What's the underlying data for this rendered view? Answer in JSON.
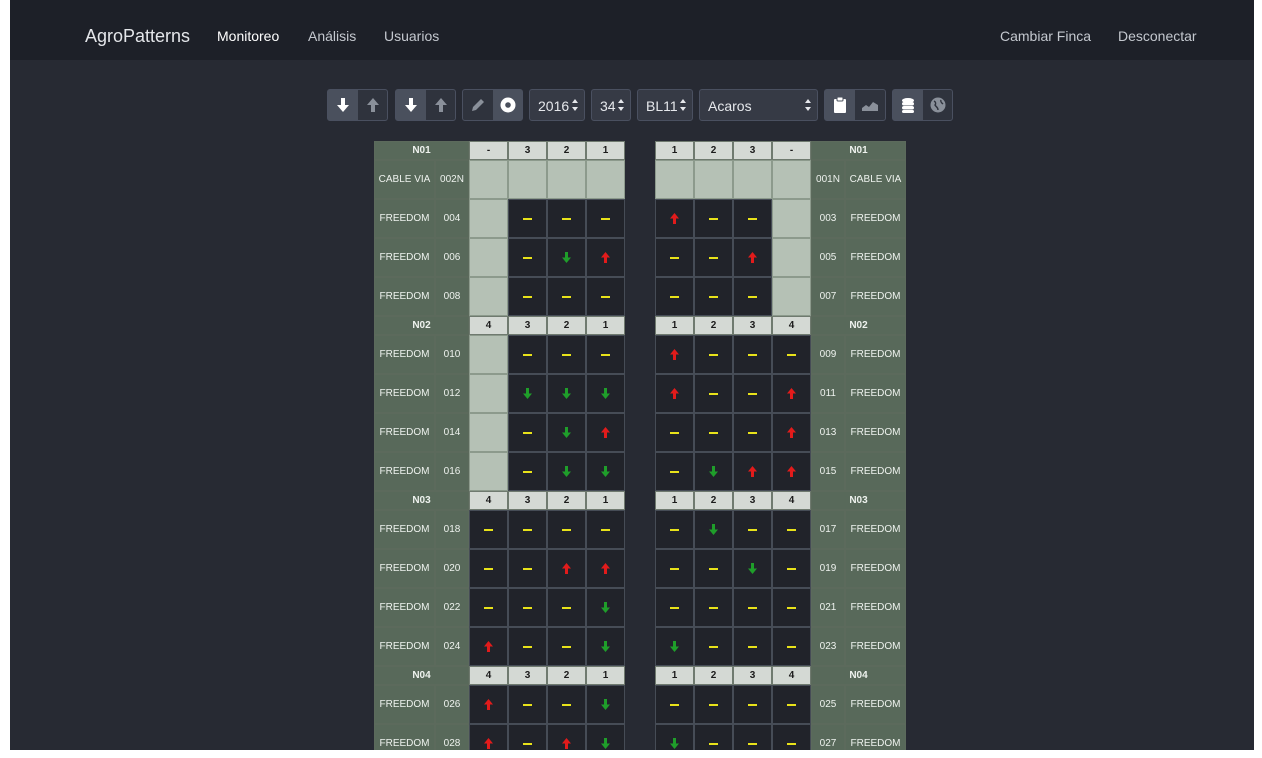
{
  "navbar": {
    "brand": "AgroPatterns",
    "links": [
      "Monitoreo",
      "Análisis",
      "Usuarios"
    ],
    "right_links": [
      "Cambiar Finca",
      "Desconectar"
    ],
    "active": "Monitoreo"
  },
  "toolbar": {
    "year": "2016",
    "week": "34",
    "block": "BL11",
    "pest": "Acaros",
    "icons": [
      "arrow-down-icon",
      "arrow-up-icon",
      "arrow-down-icon",
      "arrow-up-icon",
      "pencil-icon",
      "record-icon",
      "clipboard-icon",
      "area-chart-icon",
      "database-icon",
      "globe-icon"
    ]
  },
  "colors": {
    "dash": "#e8e21a",
    "up": "#e21b1b",
    "down": "#1f9e2a",
    "label_bg": "#58695a",
    "empty_bg": "#b5c1b5"
  },
  "grid": {
    "left": {
      "sections": [
        {
          "name": "N01",
          "headers": [
            "-",
            "3",
            "2",
            "1"
          ],
          "rows": [
            {
              "label": "CABLE VIA",
              "num": "002N",
              "cells": [
                "E",
                "E",
                "E",
                "E"
              ]
            },
            {
              "label": "FREEDOM",
              "num": "004",
              "cells": [
                "E",
                "D",
                "D",
                "D"
              ]
            },
            {
              "label": "FREEDOM",
              "num": "006",
              "cells": [
                "E",
                "D",
                "V",
                "U"
              ]
            },
            {
              "label": "FREEDOM",
              "num": "008",
              "cells": [
                "E",
                "D",
                "D",
                "D"
              ]
            }
          ]
        },
        {
          "name": "N02",
          "headers": [
            "4",
            "3",
            "2",
            "1"
          ],
          "rows": [
            {
              "label": "FREEDOM",
              "num": "010",
              "cells": [
                "E",
                "D",
                "D",
                "D"
              ]
            },
            {
              "label": "FREEDOM",
              "num": "012",
              "cells": [
                "E",
                "V",
                "V",
                "V"
              ]
            },
            {
              "label": "FREEDOM",
              "num": "014",
              "cells": [
                "E",
                "D",
                "V",
                "U"
              ]
            },
            {
              "label": "FREEDOM",
              "num": "016",
              "cells": [
                "E",
                "D",
                "V",
                "V"
              ]
            }
          ]
        },
        {
          "name": "N03",
          "headers": [
            "4",
            "3",
            "2",
            "1"
          ],
          "rows": [
            {
              "label": "FREEDOM",
              "num": "018",
              "cells": [
                "D",
                "D",
                "D",
                "D"
              ]
            },
            {
              "label": "FREEDOM",
              "num": "020",
              "cells": [
                "D",
                "D",
                "U",
                "U"
              ]
            },
            {
              "label": "FREEDOM",
              "num": "022",
              "cells": [
                "D",
                "D",
                "D",
                "V"
              ]
            },
            {
              "label": "FREEDOM",
              "num": "024",
              "cells": [
                "U",
                "D",
                "D",
                "V"
              ]
            }
          ]
        },
        {
          "name": "N04",
          "headers": [
            "4",
            "3",
            "2",
            "1"
          ],
          "rows": [
            {
              "label": "FREEDOM",
              "num": "026",
              "cells": [
                "U",
                "D",
                "D",
                "V"
              ]
            },
            {
              "label": "FREEDOM",
              "num": "028",
              "cells": [
                "U",
                "D",
                "U",
                "V"
              ]
            }
          ]
        }
      ]
    },
    "right": {
      "sections": [
        {
          "name": "N01",
          "headers": [
            "1",
            "2",
            "3",
            "-"
          ],
          "rows": [
            {
              "label": "CABLE VIA",
              "num": "001N",
              "cells": [
                "E",
                "E",
                "E",
                "E"
              ]
            },
            {
              "label": "FREEDOM",
              "num": "003",
              "cells": [
                "U",
                "D",
                "D",
                "E"
              ]
            },
            {
              "label": "FREEDOM",
              "num": "005",
              "cells": [
                "D",
                "D",
                "U",
                "E"
              ]
            },
            {
              "label": "FREEDOM",
              "num": "007",
              "cells": [
                "D",
                "D",
                "D",
                "E"
              ]
            }
          ]
        },
        {
          "name": "N02",
          "headers": [
            "1",
            "2",
            "3",
            "4"
          ],
          "rows": [
            {
              "label": "FREEDOM",
              "num": "009",
              "cells": [
                "U",
                "D",
                "D",
                "D"
              ]
            },
            {
              "label": "FREEDOM",
              "num": "011",
              "cells": [
                "U",
                "D",
                "D",
                "U"
              ]
            },
            {
              "label": "FREEDOM",
              "num": "013",
              "cells": [
                "D",
                "D",
                "D",
                "U"
              ]
            },
            {
              "label": "FREEDOM",
              "num": "015",
              "cells": [
                "D",
                "V",
                "U",
                "U"
              ]
            }
          ]
        },
        {
          "name": "N03",
          "headers": [
            "1",
            "2",
            "3",
            "4"
          ],
          "rows": [
            {
              "label": "FREEDOM",
              "num": "017",
              "cells": [
                "D",
                "V",
                "D",
                "D"
              ]
            },
            {
              "label": "FREEDOM",
              "num": "019",
              "cells": [
                "D",
                "D",
                "V",
                "D"
              ]
            },
            {
              "label": "FREEDOM",
              "num": "021",
              "cells": [
                "D",
                "D",
                "D",
                "D"
              ]
            },
            {
              "label": "FREEDOM",
              "num": "023",
              "cells": [
                "V",
                "D",
                "D",
                "D"
              ]
            }
          ]
        },
        {
          "name": "N04",
          "headers": [
            "1",
            "2",
            "3",
            "4"
          ],
          "rows": [
            {
              "label": "FREEDOM",
              "num": "025",
              "cells": [
                "D",
                "D",
                "D",
                "D"
              ]
            },
            {
              "label": "FREEDOM",
              "num": "027",
              "cells": [
                "V",
                "D",
                "D",
                "D"
              ]
            }
          ]
        }
      ]
    }
  }
}
